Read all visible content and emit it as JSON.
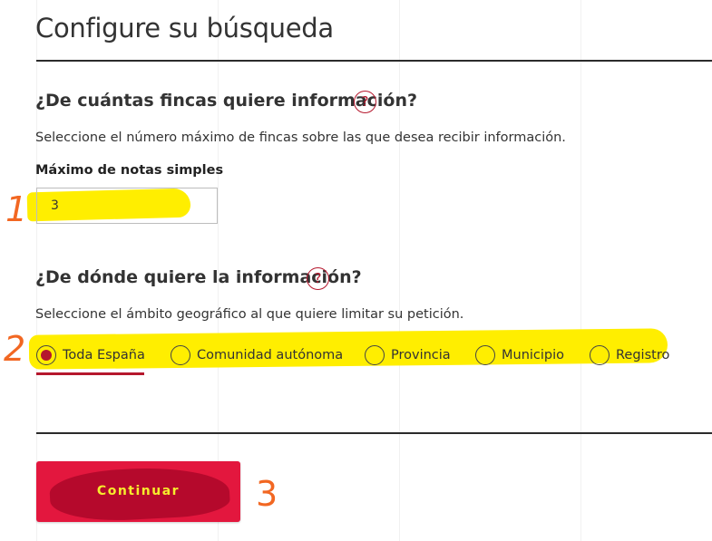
{
  "page": {
    "title": "Configure su búsqueda"
  },
  "section_count": {
    "title": "¿De cuántas fincas quiere información?",
    "help_icon": "?",
    "description": "Seleccione el número máximo de fincas sobre las que desea recibir información.",
    "field_label": "Máximo de notas simples",
    "field_value": "3"
  },
  "section_scope": {
    "title": "¿De dónde quiere la información?",
    "help_icon": "?",
    "description": "Seleccione el ámbito geográfico al que quiere limitar su petición.",
    "options": [
      {
        "label": "Toda España",
        "selected": true
      },
      {
        "label": "Comunidad autónoma",
        "selected": false
      },
      {
        "label": "Provincia",
        "selected": false
      },
      {
        "label": "Municipio",
        "selected": false
      },
      {
        "label": "Registro",
        "selected": false
      }
    ]
  },
  "actions": {
    "continue_label": "Continuar"
  },
  "annotations": {
    "step1": "1",
    "step2": "2",
    "step3": "3"
  },
  "colors": {
    "accent": "#b5172d",
    "button": "#e3173e",
    "highlight": "#ffee00",
    "annotation": "#f26722"
  },
  "icons": {
    "help": "question-circle-icon",
    "radio": "radio-icon"
  }
}
